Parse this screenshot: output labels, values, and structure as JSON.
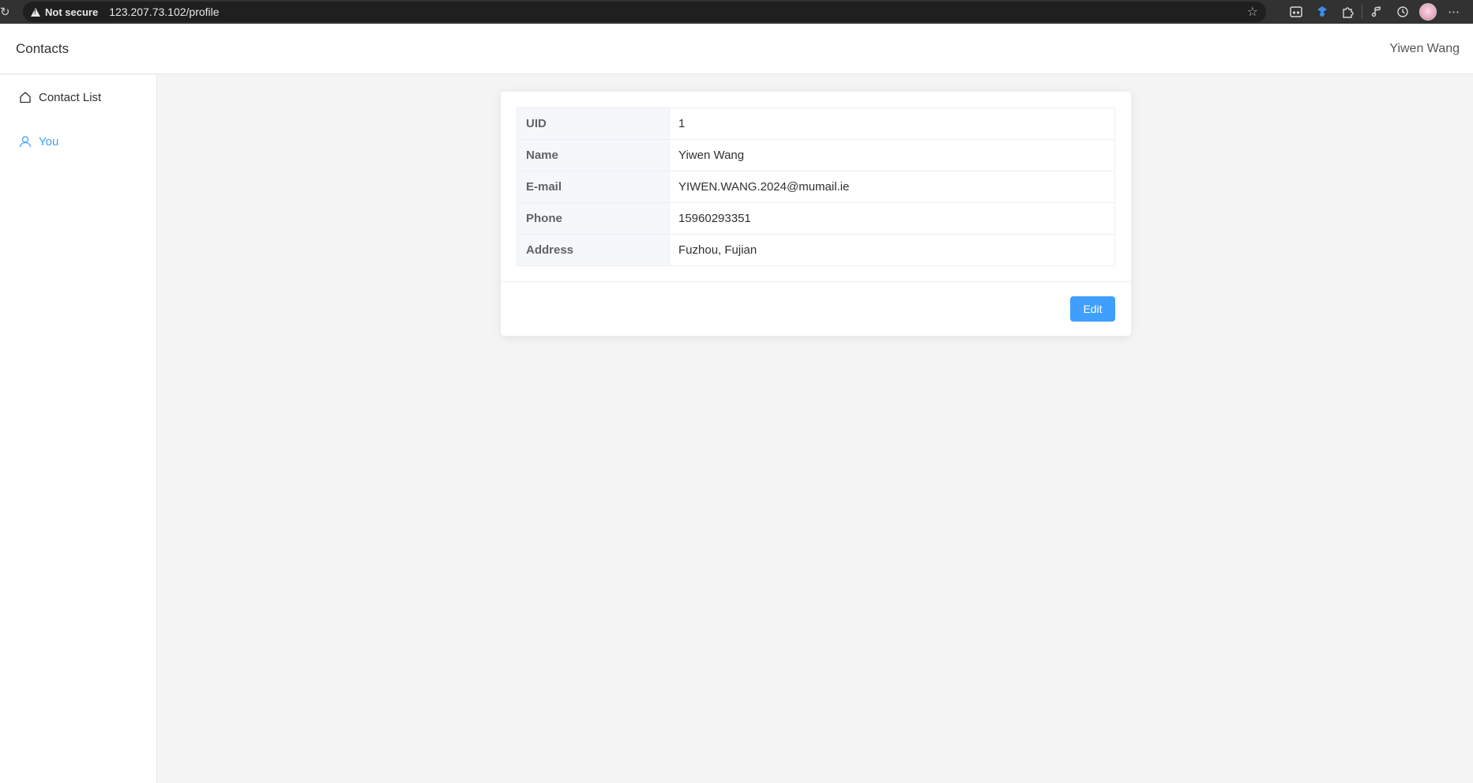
{
  "browser": {
    "security_label": "Not secure",
    "url": "123.207.73.102/profile",
    "toolbar_icons": [
      "reading-mode-icon",
      "extension-blue-icon",
      "extensions-icon",
      "media-icon",
      "history-icon",
      "profile-avatar",
      "more-icon"
    ]
  },
  "header": {
    "title": "Contacts",
    "user_name": "Yiwen Wang"
  },
  "sidebar": {
    "items": [
      {
        "label": "Contact List",
        "icon": "home-icon",
        "active": false
      },
      {
        "label": "You",
        "icon": "user-icon",
        "active": true
      }
    ]
  },
  "profile": {
    "rows": [
      {
        "label": "UID",
        "value": "1"
      },
      {
        "label": "Name",
        "value": "Yiwen Wang"
      },
      {
        "label": "E-mail",
        "value": "YIWEN.WANG.2024@mumail.ie"
      },
      {
        "label": "Phone",
        "value": "15960293351"
      },
      {
        "label": "Address",
        "value": "Fuzhou, Fujian"
      }
    ],
    "edit_label": "Edit"
  },
  "colors": {
    "accent": "#409eff",
    "header_bg": "#ffffff",
    "content_bg": "#f4f4f5",
    "browser_bar": "#323233"
  }
}
